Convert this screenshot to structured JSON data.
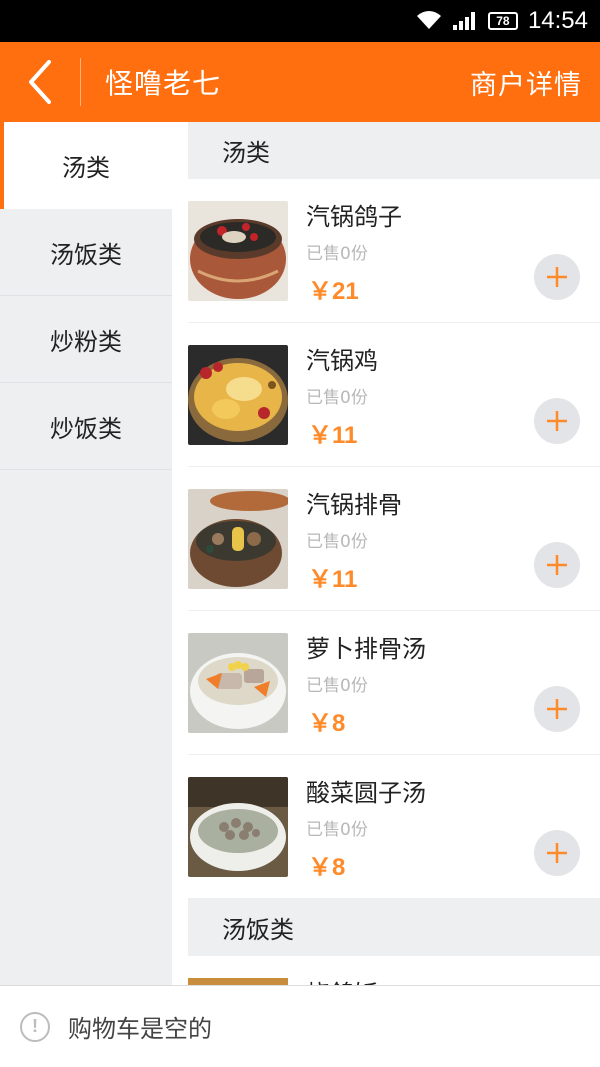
{
  "status_bar": {
    "battery": "78",
    "time": "14:54"
  },
  "header": {
    "title": "怪噜老七",
    "action": "商户详情"
  },
  "sidebar": {
    "items": [
      {
        "label": "汤类",
        "active": true
      },
      {
        "label": "汤饭类",
        "active": false
      },
      {
        "label": "炒粉类",
        "active": false
      },
      {
        "label": "炒饭类",
        "active": false
      }
    ]
  },
  "sections": [
    {
      "title": "汤类",
      "items": [
        {
          "name": "汽锅鸽子",
          "sold": "已售0份",
          "price": "￥21"
        },
        {
          "name": "汽锅鸡",
          "sold": "已售0份",
          "price": "￥11"
        },
        {
          "name": "汽锅排骨",
          "sold": "已售0份",
          "price": "￥11"
        },
        {
          "name": "萝卜排骨汤",
          "sold": "已售0份",
          "price": "￥8"
        },
        {
          "name": "酸菜圆子汤",
          "sold": "已售0份",
          "price": "￥8"
        }
      ]
    },
    {
      "title": "汤饭类",
      "items": [
        {
          "name": "烧鸽饭"
        }
      ]
    }
  ],
  "cart": {
    "text": "购物车是空的",
    "icon": "exclamation-icon"
  },
  "colors": {
    "accent": "#ff6f0f",
    "price": "#ff8a2a"
  }
}
